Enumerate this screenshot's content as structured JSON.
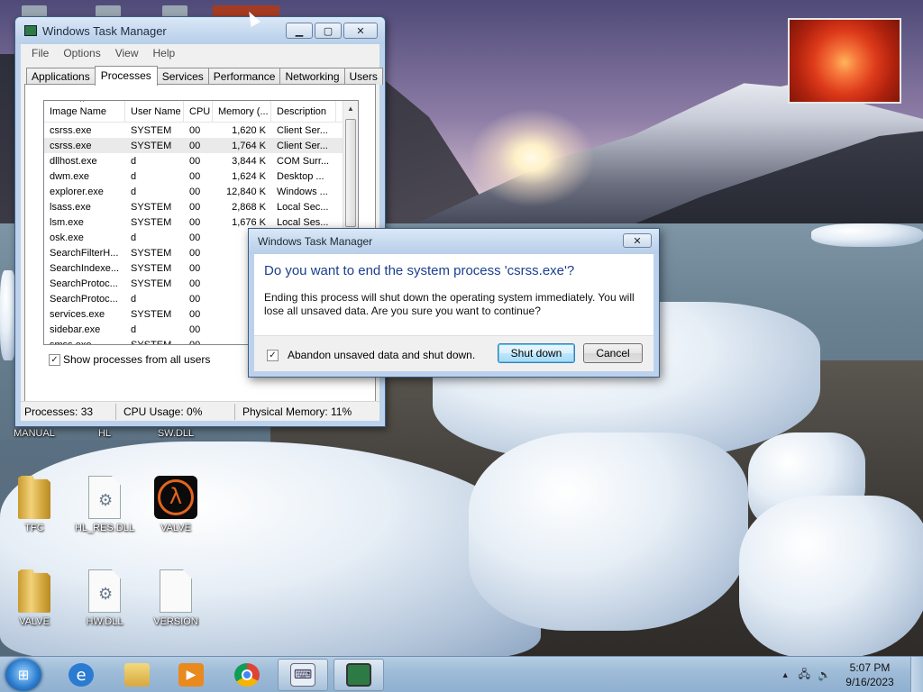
{
  "desktop": {
    "icon_rows_partial": [
      "MANUAL",
      "HL",
      "SW.DLL"
    ],
    "icons": [
      {
        "label": "TFC",
        "kind": "folder"
      },
      {
        "label": "HL_RES.DLL",
        "kind": "dll"
      },
      {
        "label": "VALVE",
        "kind": "half-life"
      },
      {
        "label": "VALVE",
        "kind": "folder"
      },
      {
        "label": "HW.DLL",
        "kind": "dll"
      },
      {
        "label": "VERSION",
        "kind": "file"
      }
    ]
  },
  "task_manager": {
    "title": "Windows Task Manager",
    "menu": [
      "File",
      "Options",
      "View",
      "Help"
    ],
    "tabs": [
      "Applications",
      "Processes",
      "Services",
      "Performance",
      "Networking",
      "Users"
    ],
    "active_tab": "Processes",
    "columns": [
      "Image Name",
      "User Name",
      "CPU",
      "Memory (...",
      "Description"
    ],
    "rows": [
      {
        "name": "csrss.exe",
        "user": "SYSTEM",
        "cpu": "00",
        "mem": "1,620 K",
        "desc": "Client Ser..."
      },
      {
        "name": "csrss.exe",
        "user": "SYSTEM",
        "cpu": "00",
        "mem": "1,764 K",
        "desc": "Client Ser..."
      },
      {
        "name": "dllhost.exe",
        "user": "d",
        "cpu": "00",
        "mem": "3,844 K",
        "desc": "COM Surr..."
      },
      {
        "name": "dwm.exe",
        "user": "d",
        "cpu": "00",
        "mem": "1,624 K",
        "desc": "Desktop ..."
      },
      {
        "name": "explorer.exe",
        "user": "d",
        "cpu": "00",
        "mem": "12,840 K",
        "desc": "Windows ..."
      },
      {
        "name": "lsass.exe",
        "user": "SYSTEM",
        "cpu": "00",
        "mem": "2,868 K",
        "desc": "Local Sec..."
      },
      {
        "name": "lsm.exe",
        "user": "SYSTEM",
        "cpu": "00",
        "mem": "1,676 K",
        "desc": "Local Ses..."
      },
      {
        "name": "osk.exe",
        "user": "d",
        "cpu": "00",
        "mem": "4,6",
        "desc": ""
      },
      {
        "name": "SearchFilterH...",
        "user": "SYSTEM",
        "cpu": "00",
        "mem": "2,2",
        "desc": ""
      },
      {
        "name": "SearchIndexe...",
        "user": "SYSTEM",
        "cpu": "00",
        "mem": "6,0",
        "desc": ""
      },
      {
        "name": "SearchProtoc...",
        "user": "SYSTEM",
        "cpu": "00",
        "mem": "2,5",
        "desc": ""
      },
      {
        "name": "SearchProtoc...",
        "user": "d",
        "cpu": "00",
        "mem": "1,9",
        "desc": ""
      },
      {
        "name": "services.exe",
        "user": "SYSTEM",
        "cpu": "00",
        "mem": "4,3",
        "desc": ""
      },
      {
        "name": "sidebar.exe",
        "user": "d",
        "cpu": "00",
        "mem": "6,4",
        "desc": ""
      },
      {
        "name": "smss.exe",
        "user": "SYSTEM",
        "cpu": "00",
        "mem": "5",
        "desc": ""
      }
    ],
    "show_all_label": "Show processes from all users",
    "show_all_checked": "✓",
    "status": {
      "processes": "Processes: 33",
      "cpu": "CPU Usage: 0%",
      "memory": "Physical Memory: 11%"
    }
  },
  "dialog": {
    "title": "Windows Task Manager",
    "question": "Do you want to end the system process 'csrss.exe'?",
    "message": "Ending this process will shut down the operating system immediately.  You will lose all unsaved data.  Are you sure you want to continue?",
    "abandon_label": "Abandon unsaved data and shut down.",
    "abandon_checked": "✓",
    "shutdown_label": "Shut down",
    "cancel_label": "Cancel"
  },
  "taskbar": {
    "items": [
      "start-orb",
      "internet-explorer",
      "windows-explorer",
      "media-player",
      "chrome",
      "on-screen-keyboard",
      "task-manager"
    ],
    "clock_time": "5:07 PM",
    "clock_date": "9/16/2023"
  }
}
